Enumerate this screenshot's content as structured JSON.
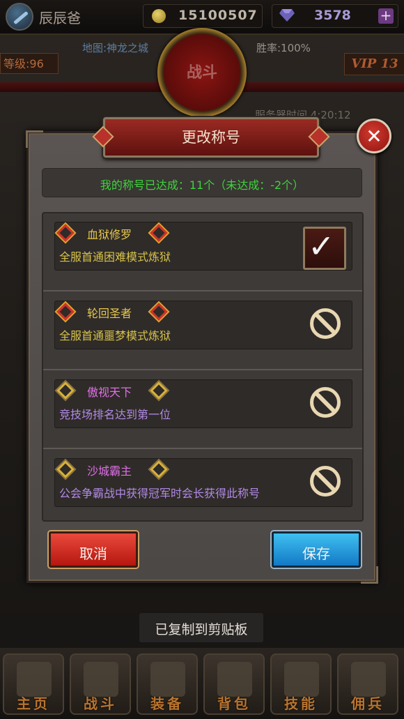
{
  "player": {
    "name": "辰辰爸"
  },
  "currency": {
    "gold": "15100507",
    "gems": "3578",
    "plus": "+"
  },
  "status_bar": {
    "map": "地图:神龙之城",
    "win_rate": "胜率:100%",
    "level": "等级:96",
    "vip": "VIP 13",
    "battle": "战斗",
    "server_time": "服务器时间 4:20:12"
  },
  "dialog": {
    "title": "更改称号",
    "close": "✕",
    "summary": "我的称号已达成：11个（未达成：-2个）",
    "titles": [
      {
        "name": "血狱修罗",
        "desc": "全服首通困难模式炼狱",
        "state": "selected"
      },
      {
        "name": "轮回圣者",
        "desc": "全服首通噩梦模式炼狱",
        "state": "locked"
      },
      {
        "name": "傲视天下",
        "desc": "竞技场排名达到第一位",
        "state": "locked"
      },
      {
        "name": "沙城霸主",
        "desc": "公会争霸战中获得冠军时会长获得此称号",
        "state": "locked"
      }
    ],
    "cancel_label": "取消",
    "save_label": "保存"
  },
  "toast": "已复制到剪贴板",
  "nav": [
    {
      "label": "主页",
      "icon": "gate-icon"
    },
    {
      "label": "战斗",
      "icon": "swords-icon"
    },
    {
      "label": "装备",
      "icon": "armor-icon"
    },
    {
      "label": "背包",
      "icon": "bag-icon"
    },
    {
      "label": "技能",
      "icon": "scroll-icon"
    },
    {
      "label": "佣兵",
      "icon": "helmet-icon"
    }
  ],
  "colors": {
    "accent_red": "#b5160f",
    "accent_blue": "#1279c6",
    "achieved_green": "#3fd43b"
  }
}
